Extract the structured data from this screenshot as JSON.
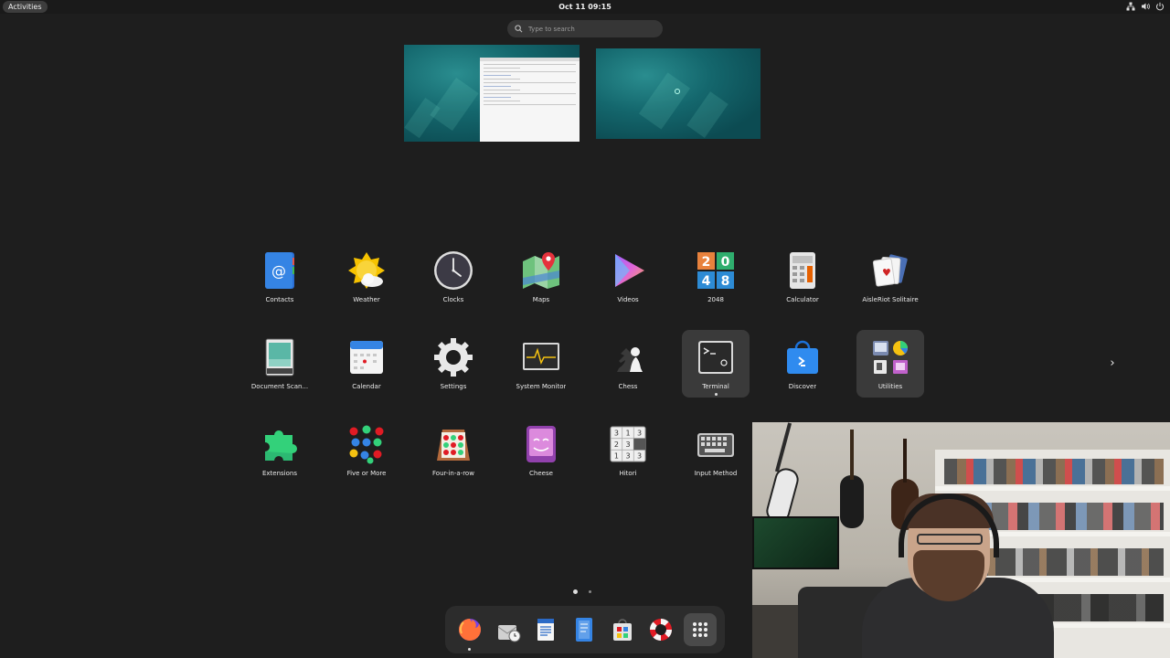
{
  "topbar": {
    "activities_label": "Activities",
    "clock": "Oct 11  09:15",
    "tray_icons": [
      "network-icon",
      "volume-icon",
      "power-icon"
    ]
  },
  "search": {
    "placeholder": "Type to search"
  },
  "workspaces": [
    {
      "name": "workspace-1",
      "has_window": true
    },
    {
      "name": "workspace-2",
      "has_window": false
    }
  ],
  "apps": [
    {
      "label": "Contacts",
      "icon": "contacts-icon"
    },
    {
      "label": "Weather",
      "icon": "weather-icon"
    },
    {
      "label": "Clocks",
      "icon": "clocks-icon"
    },
    {
      "label": "Maps",
      "icon": "maps-icon"
    },
    {
      "label": "Videos",
      "icon": "videos-icon"
    },
    {
      "label": "2048",
      "icon": "game-2048-icon"
    },
    {
      "label": "Calculator",
      "icon": "calculator-icon"
    },
    {
      "label": "AisleRiot Solitaire",
      "icon": "solitaire-icon"
    },
    {
      "label": "Document Scan...",
      "icon": "document-scanner-icon"
    },
    {
      "label": "Calendar",
      "icon": "calendar-icon"
    },
    {
      "label": "Settings",
      "icon": "settings-icon"
    },
    {
      "label": "System Monitor",
      "icon": "system-monitor-icon"
    },
    {
      "label": "Chess",
      "icon": "chess-icon"
    },
    {
      "label": "Terminal",
      "icon": "terminal-icon"
    },
    {
      "label": "Discover",
      "icon": "discover-icon"
    },
    {
      "label": "Utilities",
      "icon": "utilities-folder-icon"
    },
    {
      "label": "Extensions",
      "icon": "extensions-icon"
    },
    {
      "label": "Five or More",
      "icon": "five-or-more-icon"
    },
    {
      "label": "Four-in-a-row",
      "icon": "four-in-a-row-icon"
    },
    {
      "label": "Cheese",
      "icon": "cheese-icon"
    },
    {
      "label": "Hitori",
      "icon": "hitori-icon"
    },
    {
      "label": "Input Method",
      "icon": "input-method-icon"
    }
  ],
  "pager": {
    "next_icon": "›",
    "pages": 2,
    "current": 1
  },
  "dash": {
    "items": [
      "firefox-icon",
      "mail-icon",
      "writer-icon",
      "text-editor-icon",
      "software-icon",
      "help-icon",
      "show-apps-icon"
    ]
  },
  "colors": {
    "background": "#1e1e1e",
    "topbar": "#1a1a1a",
    "dash": "#2c2c2c",
    "selection": "#3a3a3a"
  }
}
